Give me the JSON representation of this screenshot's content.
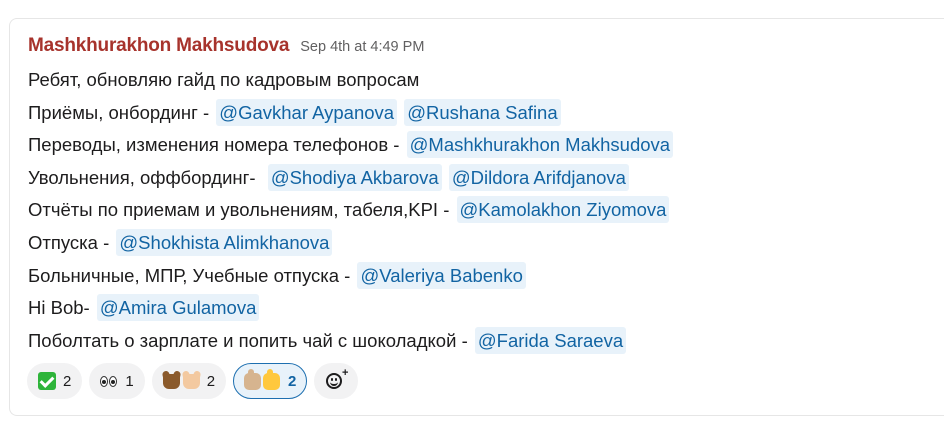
{
  "message": {
    "author": "Mashkhurakhon Makhsudova",
    "timestamp": "Sep 4th at 4:49 PM",
    "lines": [
      {
        "text": "Ребят, обновляю гайд по кадровым вопросам",
        "mentions": []
      },
      {
        "text": "Приёмы, онбординг -",
        "mentions": [
          "@Gavkhar Aypanova",
          "@Rushana Safina"
        ]
      },
      {
        "text": "Переводы, изменения номера телефонов -",
        "mentions": [
          "@Mashkhurakhon Makhsudova"
        ]
      },
      {
        "text": "Увольнения, оффбординг- ",
        "mentions": [
          "@Shodiya Akbarova",
          "@Dildora Arifdjanova"
        ]
      },
      {
        "text": "Отчёты по приемам и увольнениям, табеля,KPI -",
        "mentions": [
          "@Kamolakhon Ziyomova"
        ]
      },
      {
        "text": "Отпуска -",
        "mentions": [
          "@Shokhista Alimkhanova"
        ]
      },
      {
        "text": "Больничные, МПР, Учебные отпуска -",
        "mentions": [
          "@Valeriya Babenko"
        ]
      },
      {
        "text": "Hi Bob-",
        "mentions": [
          "@Amira Gulamova"
        ]
      },
      {
        "text": "Поболтать о зарплате и попить чай с шоколадкой -",
        "mentions": [
          "@Farida Saraeva"
        ]
      }
    ]
  },
  "reactions": [
    {
      "emoji": "white-check-mark-icon",
      "count": "2",
      "active": false
    },
    {
      "emoji": "eyes-icon",
      "count": "1",
      "active": false
    },
    {
      "emoji": "raised-hands-icon",
      "count": "2",
      "active": false
    },
    {
      "emoji": "thumbs-up-icon",
      "count": "2",
      "active": true
    }
  ],
  "colors": {
    "author": "#a7332c",
    "mention_text": "#1264a3",
    "mention_bg": "#e8f2fa",
    "active_reaction_border": "#1d6fb0"
  }
}
